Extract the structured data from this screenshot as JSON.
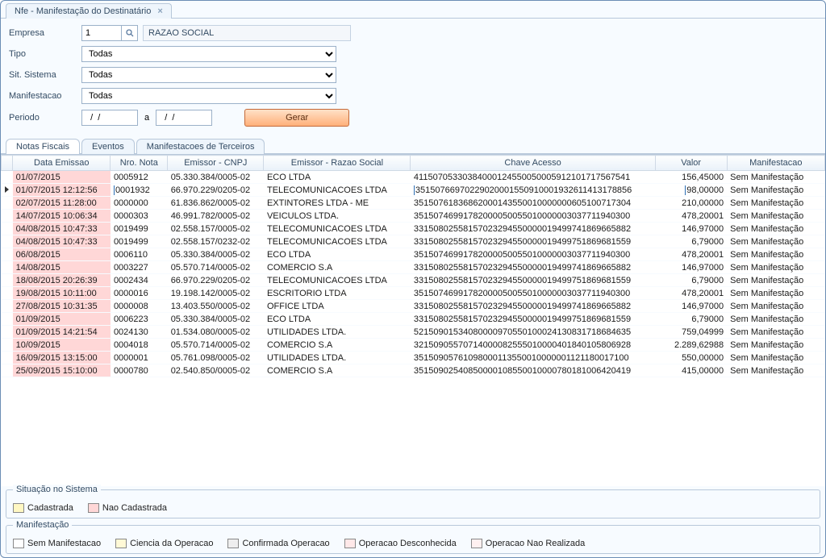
{
  "window": {
    "title": "Nfe - Manifestação do Destinatário"
  },
  "form": {
    "empresa_label": "Empresa",
    "empresa_value": "1",
    "empresa_razao": "RAZAO SOCIAL",
    "tipo_label": "Tipo",
    "tipo_value": "Todas",
    "sit_label": "Sit. Sistema",
    "sit_value": "Todas",
    "manif_label": "Manifestacao",
    "manif_value": "Todas",
    "periodo_label": "Periodo",
    "periodo_de": "  /  /",
    "periodo_sep": "a",
    "periodo_ate": "  /  /",
    "gerar_label": "Gerar"
  },
  "tabs": {
    "t0": "Notas Fiscais",
    "t1": "Eventos",
    "t2": "Manifestacoes de Terceiros"
  },
  "grid": {
    "headers": {
      "data": "Data Emissao",
      "nro": "Nro. Nota",
      "cnpj": "Emissor - CNPJ",
      "razao": "Emissor - Razao Social",
      "chave": "Chave Acesso",
      "valor": "Valor",
      "manif": "Manifestacao"
    },
    "rows": [
      {
        "sel": false,
        "data": "01/07/2015",
        "nro": "0005912",
        "cnpj": "05.330.384/0005-02",
        "razao": "ECO LTDA",
        "chave": "41150705330384000124550050005912101717567541",
        "valor": "156,45000",
        "manif": "Sem Manifestação"
      },
      {
        "sel": true,
        "data": "01/07/2015 12:12:56",
        "nro": "0001932",
        "cnpj": "66.970.229/0205-02",
        "razao": "TELECOMUNICACOES LTDA",
        "chave": "35150766970229020001550910001932611413178856",
        "valor": "98,00000",
        "manif": "Sem Manifestação"
      },
      {
        "sel": false,
        "data": "02/07/2015 11:28:00",
        "nro": "0000000",
        "cnpj": "61.836.862/0005-02",
        "razao": "EXTINTORES LTDA - ME",
        "chave": "35150761836862000143550010000000605100717304",
        "valor": "210,00000",
        "manif": "Sem Manifestação"
      },
      {
        "sel": false,
        "data": "14/07/2015 10:06:34",
        "nro": "0000303",
        "cnpj": "46.991.782/0005-02",
        "razao": "VEICULOS LTDA.",
        "chave": "35150746991782000050055010000003037711940300",
        "valor": "478,20001",
        "manif": "Sem Manifestação"
      },
      {
        "sel": false,
        "data": "04/08/2015 10:47:33",
        "nro": "0019499",
        "cnpj": "02.558.157/0005-02",
        "razao": "TELECOMUNICACOES LTDA",
        "chave": "33150802558157023294550000019499741869665882",
        "valor": "146,97000",
        "manif": "Sem Manifestação"
      },
      {
        "sel": false,
        "data": "04/08/2015 10:47:33",
        "nro": "0019499",
        "cnpj": "02.558.157/0232-02",
        "razao": "TELECOMUNICACOES LTDA",
        "chave": "33150802558157023294550000019499751869681559",
        "valor": "6,79000",
        "manif": "Sem Manifestação"
      },
      {
        "sel": false,
        "data": "06/08/2015",
        "nro": "0006110",
        "cnpj": "05.330.384/0005-02",
        "razao": "ECO LTDA",
        "chave": "35150746991782000050055010000003037711940300",
        "valor": "478,20001",
        "manif": "Sem Manifestação"
      },
      {
        "sel": false,
        "data": "14/08/2015",
        "nro": "0003227",
        "cnpj": "05.570.714/0005-02",
        "razao": "COMERCIO S.A",
        "chave": "33150802558157023294550000019499741869665882",
        "valor": "146,97000",
        "manif": "Sem Manifestação"
      },
      {
        "sel": false,
        "data": "18/08/2015 20:26:39",
        "nro": "0002434",
        "cnpj": "66.970.229/0205-02",
        "razao": "TELECOMUNICACOES LTDA",
        "chave": "33150802558157023294550000019499751869681559",
        "valor": "6,79000",
        "manif": "Sem Manifestação"
      },
      {
        "sel": false,
        "data": "19/08/2015 10:11:00",
        "nro": "0000016",
        "cnpj": "19.198.142/0005-02",
        "razao": "ESCRITORIO LTDA",
        "chave": "35150746991782000050055010000003037711940300",
        "valor": "478,20001",
        "manif": "Sem Manifestação"
      },
      {
        "sel": false,
        "data": "27/08/2015 10:31:35",
        "nro": "0000008",
        "cnpj": "13.403.550/0005-02",
        "razao": "OFFICE LTDA",
        "chave": "33150802558157023294550000019499741869665882",
        "valor": "146,97000",
        "manif": "Sem Manifestação"
      },
      {
        "sel": false,
        "data": "01/09/2015",
        "nro": "0006223",
        "cnpj": "05.330.384/0005-02",
        "razao": "ECO LTDA",
        "chave": "33150802558157023294550000019499751869681559",
        "valor": "6,79000",
        "manif": "Sem Manifestação"
      },
      {
        "sel": false,
        "data": "01/09/2015 14:21:54",
        "nro": "0024130",
        "cnpj": "01.534.080/0005-02",
        "razao": "UTILIDADES LTDA.",
        "chave": "52150901534080000970550100024130831718684635",
        "valor": "759,04999",
        "manif": "Sem Manifestação"
      },
      {
        "sel": false,
        "data": "10/09/2015",
        "nro": "0004018",
        "cnpj": "05.570.714/0005-02",
        "razao": "COMERCIO S.A",
        "chave": "32150905570714000082555010000401840105806928",
        "valor": "2.289,62988",
        "manif": "Sem Manifestação"
      },
      {
        "sel": false,
        "data": "16/09/2015 13:15:00",
        "nro": "0000001",
        "cnpj": "05.761.098/0005-02",
        "razao": "UTILIDADES LTDA.",
        "chave": "35150905761098000113550010000001121180017100",
        "valor": "550,00000",
        "manif": "Sem Manifestação"
      },
      {
        "sel": false,
        "data": "25/09/2015 15:10:00",
        "nro": "0000780",
        "cnpj": "02.540.850/0005-02",
        "razao": "COMERCIO S.A",
        "chave": "35150902540850000108550010000780181006420419",
        "valor": "415,00000",
        "manif": "Sem Manifestação"
      }
    ]
  },
  "legend1": {
    "title": "Situação no Sistema",
    "cad": "Cadastrada",
    "nao": "Nao Cadastrada"
  },
  "legend2": {
    "title": "Manifestação",
    "i0": "Sem Manifestacao",
    "i1": "Ciencia da Operacao",
    "i2": "Confirmada Operacao",
    "i3": "Operacao Desconhecida",
    "i4": "Operacao Nao Realizada"
  }
}
